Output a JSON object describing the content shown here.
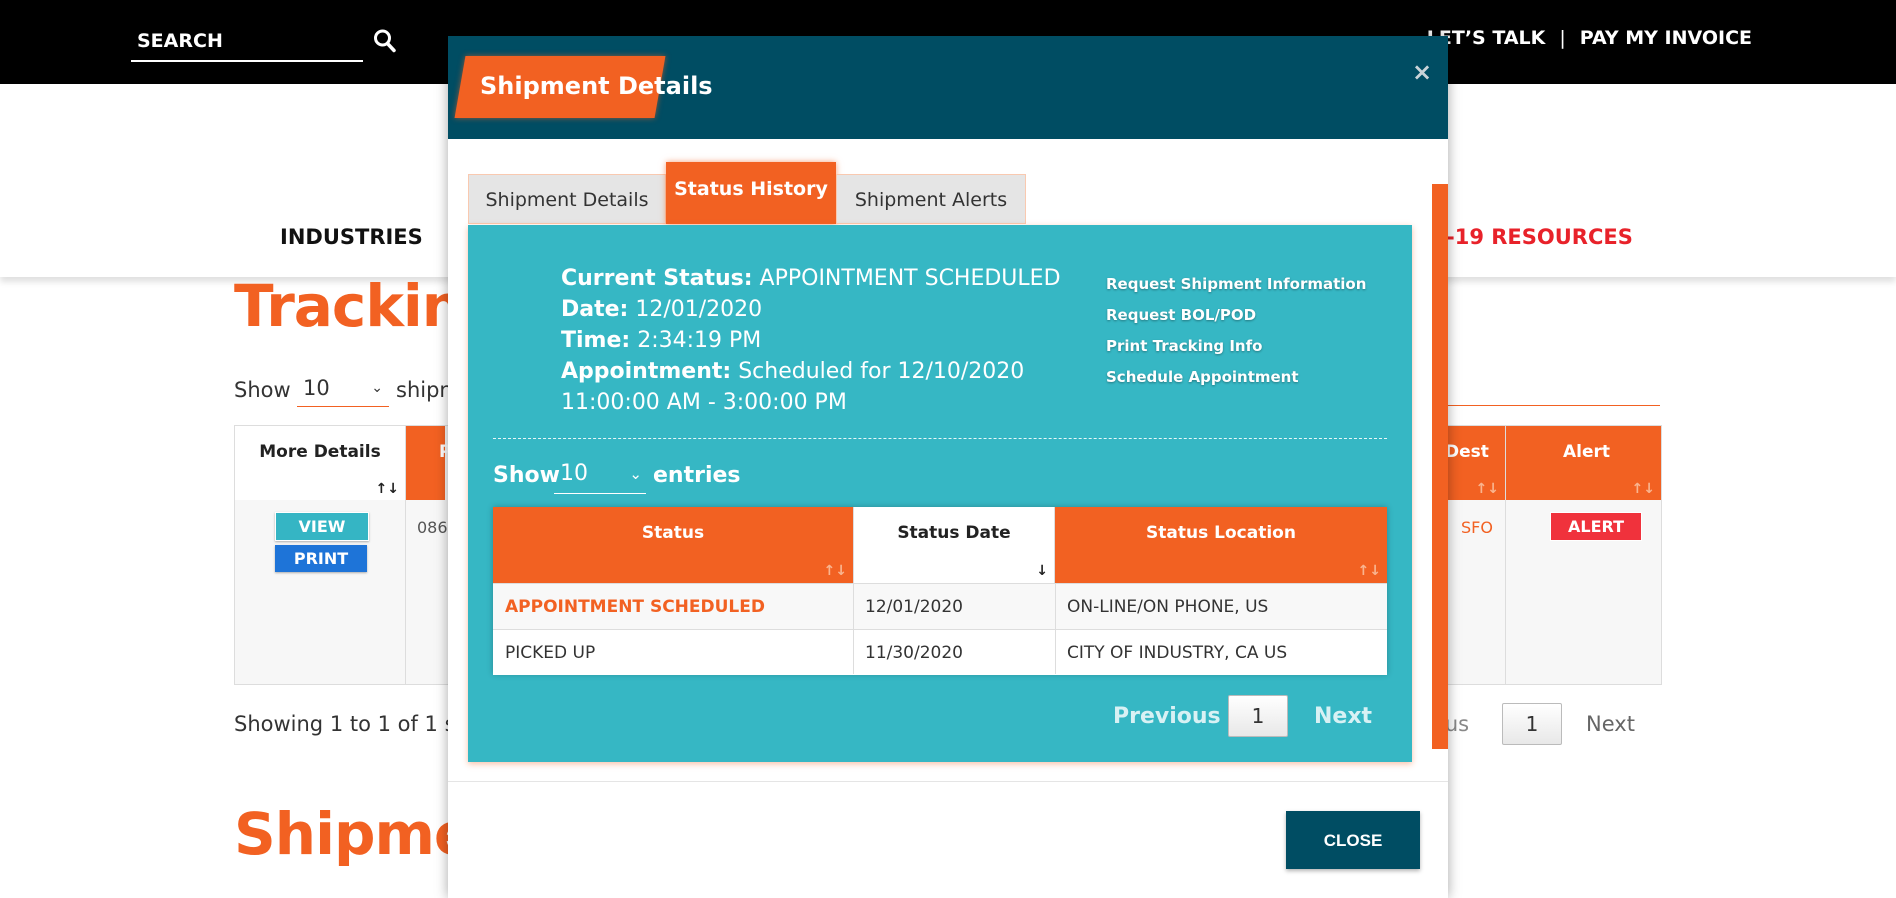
{
  "topbar": {
    "search_placeholder": "SEARCH",
    "nav_items": [
      "LET’S TALK",
      "PAY MY INVOICE"
    ],
    "separator": "|"
  },
  "header": {
    "industries": "INDUSTRIES",
    "resources": "-19 RESOURCES"
  },
  "page": {
    "tracking_title": "Trackin",
    "shipments_title": "Shipme",
    "show_label": "Show",
    "show_value": "10",
    "ships_label": "shipn",
    "showing_text": "Showing 1 to 1 of 1 s",
    "prev_label": "ous",
    "page_number": "1",
    "next_label": "Next",
    "table": {
      "headers": {
        "more_details": "More Details",
        "pro": "P",
        "dest": "Dest",
        "alert": "Alert"
      },
      "row": {
        "view": "VIEW",
        "print": "PRINT",
        "pro": "086",
        "dest": "SFO",
        "alert": "ALERT"
      }
    }
  },
  "modal": {
    "title": "Shipment Details",
    "close_x": "×",
    "tabs": [
      "Shipment Details",
      "Status History",
      "Shipment Alerts"
    ],
    "active_tab": "Status History",
    "current_status": {
      "status_label": "Current Status:",
      "status_value": "APPOINTMENT SCHEDULED",
      "date_label": "Date:",
      "date_value": "12/01/2020",
      "time_label": "Time:",
      "time_value": "2:34:19 PM",
      "appt_label": "Appointment:",
      "appt_value": "Scheduled for 12/10/2020",
      "appt_window": "11:00:00 AM - 3:00:00 PM"
    },
    "links": [
      "Request Shipment Information",
      "Request BOL/POD",
      "Print Tracking Info",
      "Schedule Appointment"
    ],
    "show_label": "Show",
    "show_value": "10",
    "entries_label": "entries",
    "table": {
      "headers": [
        "Status",
        "Status Date",
        "Status Location"
      ],
      "rows": [
        {
          "status": "APPOINTMENT SCHEDULED",
          "date": "12/01/2020",
          "location": "ON-LINE/ON PHONE, US"
        },
        {
          "status": "PICKED UP",
          "date": "11/30/2020",
          "location": "CITY OF INDUSTRY, CA US"
        }
      ]
    },
    "pagination": {
      "previous": "Previous",
      "page": "1",
      "next": "Next"
    },
    "close_button": "CLOSE"
  },
  "colors": {
    "orange": "#f26122",
    "teal": "#36b7c4",
    "navy": "#004d63",
    "alert_red": "#f0323c",
    "print_blue": "#1e74d8"
  }
}
